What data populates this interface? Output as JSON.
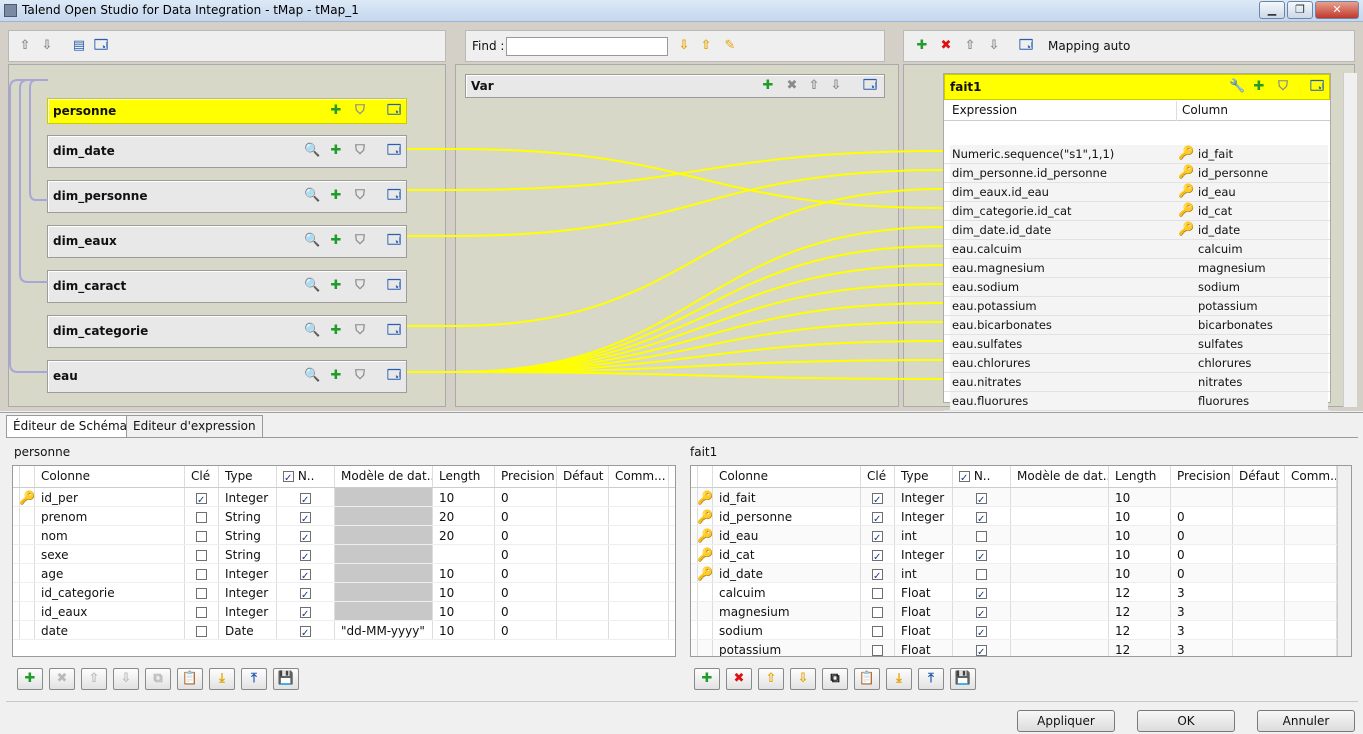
{
  "window": {
    "title": "Talend Open Studio for Data Integration - tMap - tMap_1",
    "min": "▁",
    "max": "❐",
    "close": "✕"
  },
  "left_panel": {
    "tables": [
      {
        "name": "personne",
        "main": true
      },
      {
        "name": "dim_date"
      },
      {
        "name": "dim_personne"
      },
      {
        "name": "dim_eaux"
      },
      {
        "name": "dim_caract"
      },
      {
        "name": "dim_categorie"
      },
      {
        "name": "eau"
      }
    ]
  },
  "middle_panel": {
    "find_label": "Find :",
    "find_value": "",
    "var_title": "Var"
  },
  "right_panel": {
    "mapping_auto": "Mapping auto",
    "output_name": "fait1",
    "col_expression": "Expression",
    "col_column": "Column",
    "rows": [
      {
        "expr": "Numeric.sequence(\"s1\",1,1)",
        "col": "id_fait",
        "key": true
      },
      {
        "expr": "dim_personne.id_personne",
        "col": "id_personne",
        "key": true
      },
      {
        "expr": "dim_eaux.id_eau",
        "col": "id_eau",
        "key": true
      },
      {
        "expr": "dim_categorie.id_cat",
        "col": "id_cat",
        "key": true
      },
      {
        "expr": "dim_date.id_date",
        "col": "id_date",
        "key": true
      },
      {
        "expr": "eau.calcuim",
        "col": "calcuim",
        "key": false
      },
      {
        "expr": "eau.magnesium",
        "col": "magnesium",
        "key": false
      },
      {
        "expr": "eau.sodium",
        "col": "sodium",
        "key": false
      },
      {
        "expr": "eau.potassium",
        "col": "potassium",
        "key": false
      },
      {
        "expr": "eau.bicarbonates",
        "col": "bicarbonates",
        "key": false
      },
      {
        "expr": "eau.sulfates",
        "col": "sulfates",
        "key": false
      },
      {
        "expr": "eau.chlorures",
        "col": "chlorures",
        "key": false
      },
      {
        "expr": "eau.nitrates",
        "col": "nitrates",
        "key": false
      },
      {
        "expr": "eau.fluorures",
        "col": "fluorures",
        "key": false
      }
    ]
  },
  "tabs": {
    "schema": "Éditeur de  Schéma",
    "expression": "Editeur d'expression"
  },
  "schema_headers": [
    "Colonne",
    "Clé",
    "Type",
    "N..",
    "Modèle de dat...",
    "Length",
    "Precision",
    "Défaut",
    "Comm..."
  ],
  "left_schema": {
    "title": "personne",
    "rows": [
      {
        "col": "id_per",
        "key": true,
        "type": "Integer",
        "nullable": true,
        "model": "",
        "length": "10",
        "precision": "0",
        "model_gray": true
      },
      {
        "col": "prenom",
        "key": false,
        "type": "String",
        "nullable": true,
        "model": "",
        "length": "20",
        "precision": "0",
        "model_gray": true
      },
      {
        "col": "nom",
        "key": false,
        "type": "String",
        "nullable": true,
        "model": "",
        "length": "20",
        "precision": "0",
        "model_gray": true
      },
      {
        "col": "sexe",
        "key": false,
        "type": "String",
        "nullable": true,
        "model": "",
        "length": "",
        "precision": "0",
        "model_gray": true
      },
      {
        "col": "age",
        "key": false,
        "type": "Integer",
        "nullable": true,
        "model": "",
        "length": "10",
        "precision": "0",
        "model_gray": true
      },
      {
        "col": "id_categorie",
        "key": false,
        "type": "Integer",
        "nullable": true,
        "model": "",
        "length": "10",
        "precision": "0",
        "model_gray": true
      },
      {
        "col": "id_eaux",
        "key": false,
        "type": "Integer",
        "nullable": true,
        "model": "",
        "length": "10",
        "precision": "0",
        "model_gray": true
      },
      {
        "col": "date",
        "key": false,
        "type": "Date",
        "nullable": true,
        "model": "\"dd-MM-yyyy\"",
        "length": "10",
        "precision": "0",
        "model_gray": false
      }
    ]
  },
  "right_schema": {
    "title": "fait1",
    "rows": [
      {
        "col": "id_fait",
        "key": true,
        "type": "Integer",
        "nullable": true,
        "length": "10",
        "precision": "",
        "keyicon": true
      },
      {
        "col": "id_personne",
        "key": true,
        "type": "Integer",
        "nullable": true,
        "length": "10",
        "precision": "0",
        "keyicon": true
      },
      {
        "col": "id_eau",
        "key": true,
        "type": "int",
        "nullable": false,
        "length": "10",
        "precision": "0",
        "keyicon": true
      },
      {
        "col": "id_cat",
        "key": true,
        "type": "Integer",
        "nullable": true,
        "length": "10",
        "precision": "0",
        "keyicon": true
      },
      {
        "col": "id_date",
        "key": true,
        "type": "int",
        "nullable": false,
        "length": "10",
        "precision": "0",
        "keyicon": true
      },
      {
        "col": "calcuim",
        "key": false,
        "type": "Float",
        "nullable": true,
        "length": "12",
        "precision": "3",
        "keyicon": false
      },
      {
        "col": "magnesium",
        "key": false,
        "type": "Float",
        "nullable": true,
        "length": "12",
        "precision": "3",
        "keyicon": false
      },
      {
        "col": "sodium",
        "key": false,
        "type": "Float",
        "nullable": true,
        "length": "12",
        "precision": "3",
        "keyicon": false
      },
      {
        "col": "potassium",
        "key": false,
        "type": "Float",
        "nullable": true,
        "length": "12",
        "precision": "3",
        "keyicon": false
      }
    ]
  },
  "dialog_buttons": {
    "apply": "Appliquer",
    "ok": "OK",
    "cancel": "Annuler"
  },
  "colors": {
    "mapping_line": "#ffff00",
    "table_header": "#ffff00",
    "panel_bg": "#d8d8c8"
  },
  "icons": {
    "up": "⇧",
    "down": "⇩",
    "add": "✚",
    "remove": "✖",
    "filter": "⛉",
    "expand": "🗔",
    "key": "🔑",
    "lookup": "🔍"
  }
}
